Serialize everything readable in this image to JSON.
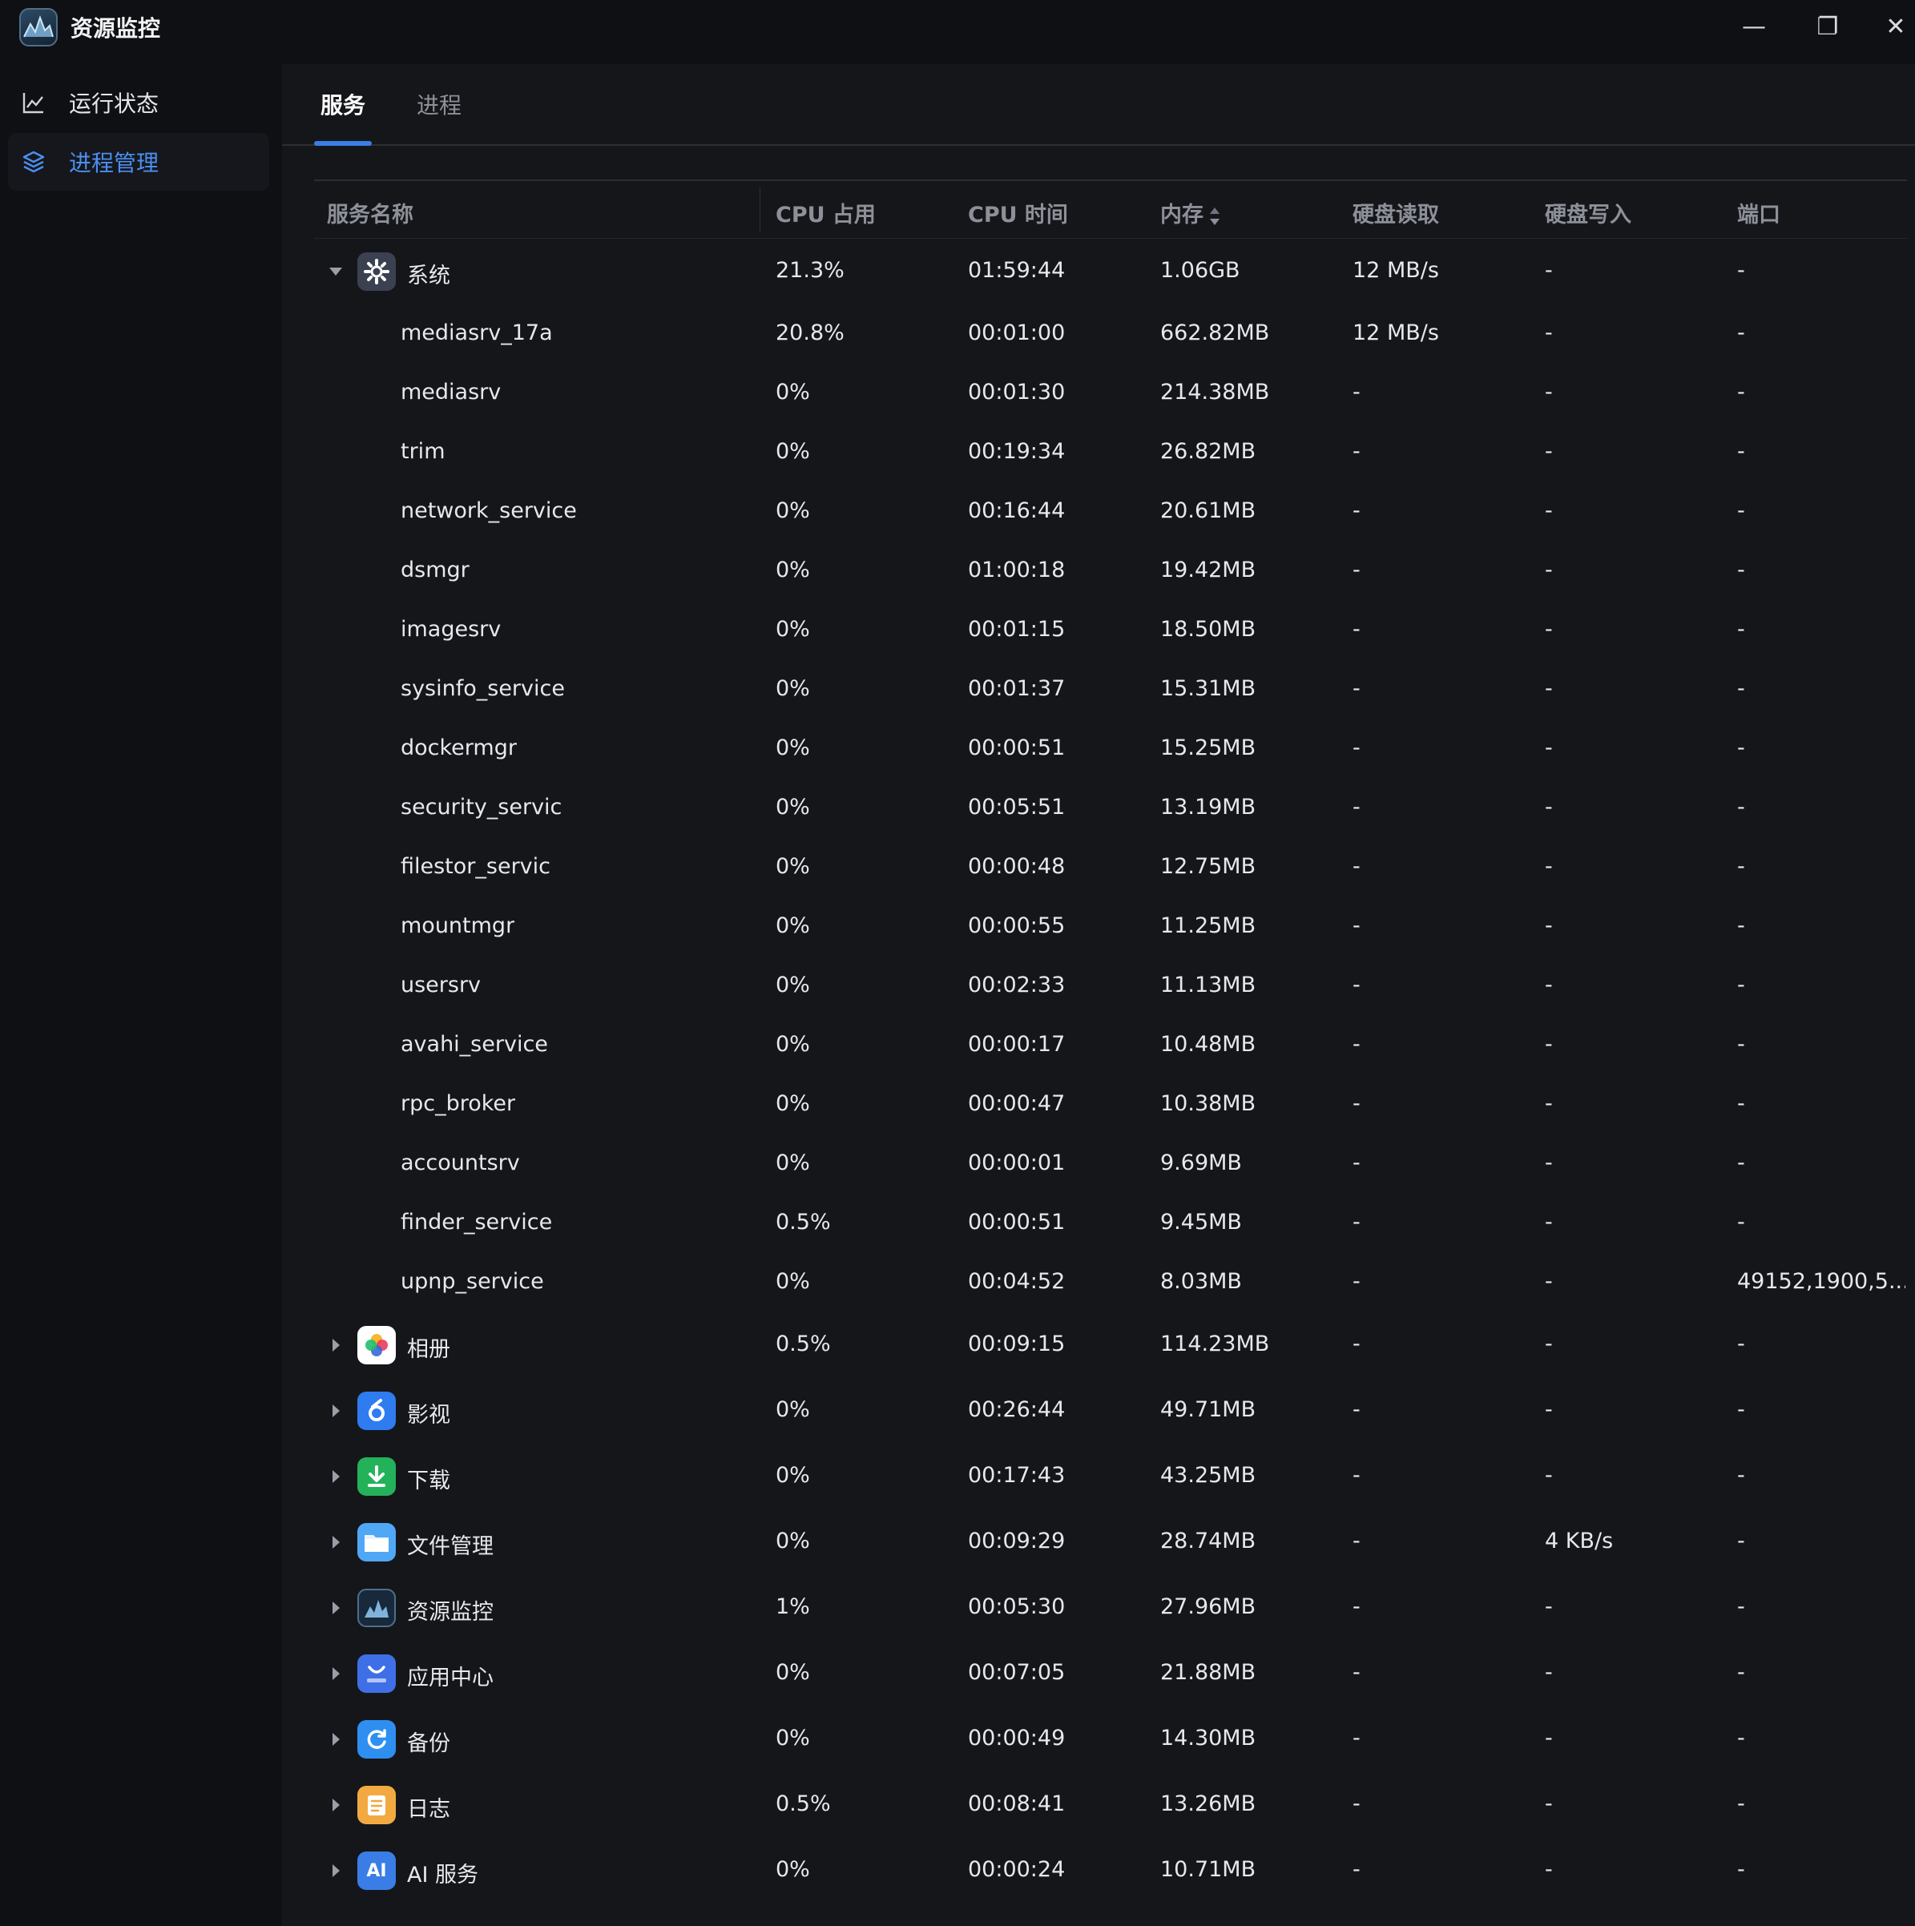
{
  "window": {
    "title": "资源监控",
    "controls": {
      "minimize": "—",
      "maximize": "❐",
      "close": "✕"
    }
  },
  "sidebar": {
    "items": [
      {
        "label": "运行状态",
        "icon": "line-chart-icon",
        "active": false
      },
      {
        "label": "进程管理",
        "icon": "layers-icon",
        "active": true
      }
    ]
  },
  "tabs": [
    {
      "label": "服务",
      "active": true
    },
    {
      "label": "进程",
      "active": false
    }
  ],
  "table": {
    "columns": [
      "服务名称",
      "CPU 占用",
      "CPU 时间",
      "内存",
      "硬盘读取",
      "硬盘写入",
      "端口"
    ],
    "sorted_column": "内存",
    "groups": [
      {
        "name": "系统",
        "icon": "gear-icon",
        "expanded": true,
        "cpu": "21.3%",
        "time": "01:59:44",
        "mem": "1.06GB",
        "read": "12 MB/s",
        "write": "-",
        "port": "-",
        "children": [
          {
            "name": "mediasrv_17a",
            "cpu": "20.8%",
            "time": "00:01:00",
            "mem": "662.82MB",
            "read": "12 MB/s",
            "write": "-",
            "port": "-"
          },
          {
            "name": "mediasrv",
            "cpu": "0%",
            "time": "00:01:30",
            "mem": "214.38MB",
            "read": "-",
            "write": "-",
            "port": "-"
          },
          {
            "name": "trim",
            "cpu": "0%",
            "time": "00:19:34",
            "mem": "26.82MB",
            "read": "-",
            "write": "-",
            "port": "-"
          },
          {
            "name": "network_service",
            "cpu": "0%",
            "time": "00:16:44",
            "mem": "20.61MB",
            "read": "-",
            "write": "-",
            "port": "-"
          },
          {
            "name": "dsmgr",
            "cpu": "0%",
            "time": "01:00:18",
            "mem": "19.42MB",
            "read": "-",
            "write": "-",
            "port": "-"
          },
          {
            "name": "imagesrv",
            "cpu": "0%",
            "time": "00:01:15",
            "mem": "18.50MB",
            "read": "-",
            "write": "-",
            "port": "-"
          },
          {
            "name": "sysinfo_service",
            "cpu": "0%",
            "time": "00:01:37",
            "mem": "15.31MB",
            "read": "-",
            "write": "-",
            "port": "-"
          },
          {
            "name": "dockermgr",
            "cpu": "0%",
            "time": "00:00:51",
            "mem": "15.25MB",
            "read": "-",
            "write": "-",
            "port": "-"
          },
          {
            "name": "security_servic",
            "cpu": "0%",
            "time": "00:05:51",
            "mem": "13.19MB",
            "read": "-",
            "write": "-",
            "port": "-"
          },
          {
            "name": "filestor_servic",
            "cpu": "0%",
            "time": "00:00:48",
            "mem": "12.75MB",
            "read": "-",
            "write": "-",
            "port": "-"
          },
          {
            "name": "mountmgr",
            "cpu": "0%",
            "time": "00:00:55",
            "mem": "11.25MB",
            "read": "-",
            "write": "-",
            "port": "-"
          },
          {
            "name": "usersrv",
            "cpu": "0%",
            "time": "00:02:33",
            "mem": "11.13MB",
            "read": "-",
            "write": "-",
            "port": "-"
          },
          {
            "name": "avahi_service",
            "cpu": "0%",
            "time": "00:00:17",
            "mem": "10.48MB",
            "read": "-",
            "write": "-",
            "port": "-"
          },
          {
            "name": "rpc_broker",
            "cpu": "0%",
            "time": "00:00:47",
            "mem": "10.38MB",
            "read": "-",
            "write": "-",
            "port": "-"
          },
          {
            "name": "accountsrv",
            "cpu": "0%",
            "time": "00:00:01",
            "mem": "9.69MB",
            "read": "-",
            "write": "-",
            "port": "-"
          },
          {
            "name": "finder_service",
            "cpu": "0.5%",
            "time": "00:00:51",
            "mem": "9.45MB",
            "read": "-",
            "write": "-",
            "port": "-"
          },
          {
            "name": "upnp_service",
            "cpu": "0%",
            "time": "00:04:52",
            "mem": "8.03MB",
            "read": "-",
            "write": "-",
            "port": "49152,1900,5..."
          }
        ]
      },
      {
        "name": "相册",
        "icon": "photos-icon",
        "expanded": false,
        "cpu": "0.5%",
        "time": "00:09:15",
        "mem": "114.23MB",
        "read": "-",
        "write": "-",
        "port": "-"
      },
      {
        "name": "影视",
        "icon": "video-icon",
        "expanded": false,
        "cpu": "0%",
        "time": "00:26:44",
        "mem": "49.71MB",
        "read": "-",
        "write": "-",
        "port": "-"
      },
      {
        "name": "下载",
        "icon": "download-icon",
        "expanded": false,
        "cpu": "0%",
        "time": "00:17:43",
        "mem": "43.25MB",
        "read": "-",
        "write": "-",
        "port": "-"
      },
      {
        "name": "文件管理",
        "icon": "folder-icon",
        "expanded": false,
        "cpu": "0%",
        "time": "00:09:29",
        "mem": "28.74MB",
        "read": "-",
        "write": "4 KB/s",
        "port": "-"
      },
      {
        "name": "资源监控",
        "icon": "monitor-icon",
        "expanded": false,
        "cpu": "1%",
        "time": "00:05:30",
        "mem": "27.96MB",
        "read": "-",
        "write": "-",
        "port": "-"
      },
      {
        "name": "应用中心",
        "icon": "store-icon",
        "expanded": false,
        "cpu": "0%",
        "time": "00:07:05",
        "mem": "21.88MB",
        "read": "-",
        "write": "-",
        "port": "-"
      },
      {
        "name": "备份",
        "icon": "backup-icon",
        "expanded": false,
        "cpu": "0%",
        "time": "00:00:49",
        "mem": "14.30MB",
        "read": "-",
        "write": "-",
        "port": "-"
      },
      {
        "name": "日志",
        "icon": "log-icon",
        "expanded": false,
        "cpu": "0.5%",
        "time": "00:08:41",
        "mem": "13.26MB",
        "read": "-",
        "write": "-",
        "port": "-"
      },
      {
        "name": "AI 服务",
        "icon": "ai-icon",
        "expanded": false,
        "cpu": "0%",
        "time": "00:00:24",
        "mem": "10.71MB",
        "read": "-",
        "write": "-",
        "port": "-"
      }
    ]
  },
  "colors": {
    "accent": "#3a7de6",
    "background": "#0f1013",
    "panel": "#15161a",
    "header_text": "#8d9099"
  }
}
